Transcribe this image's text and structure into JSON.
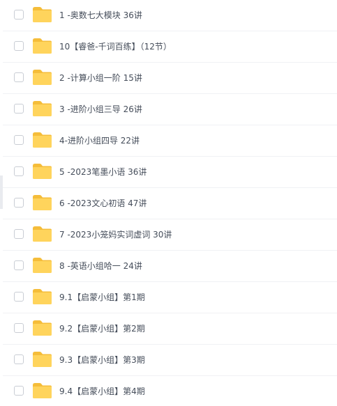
{
  "file_list": {
    "items": [
      {
        "name": "1 -奥数七大模块 36讲"
      },
      {
        "name": "10【睿爸-千词百练】（12节）"
      },
      {
        "name": "2 -计算小组一阶 15讲"
      },
      {
        "name": "3 -进阶小组三导 26讲"
      },
      {
        "name": "4-进阶小组四导 22讲"
      },
      {
        "name": "5 -2023笔墨小语 36讲"
      },
      {
        "name": "6 -2023文心初语 47讲"
      },
      {
        "name": "7 -2023小笼妈实词虚词 30讲"
      },
      {
        "name": "8 -英语小组哈一 24讲"
      },
      {
        "name": "9.1【启蒙小组】第1期"
      },
      {
        "name": "9.2【启蒙小组】第2期"
      },
      {
        "name": "9.3【启蒙小组】第3期"
      },
      {
        "name": "9.4【启蒙小组】第4期"
      }
    ]
  },
  "icons": {
    "folder": "folder-icon",
    "checkbox": "checkbox"
  },
  "colors": {
    "folder_body": "#ffd45c",
    "folder_tab": "#f5bd3a",
    "text": "#454d5a",
    "checkbox_border": "#c9cdd4",
    "row_divider": "#f0f1f4"
  }
}
